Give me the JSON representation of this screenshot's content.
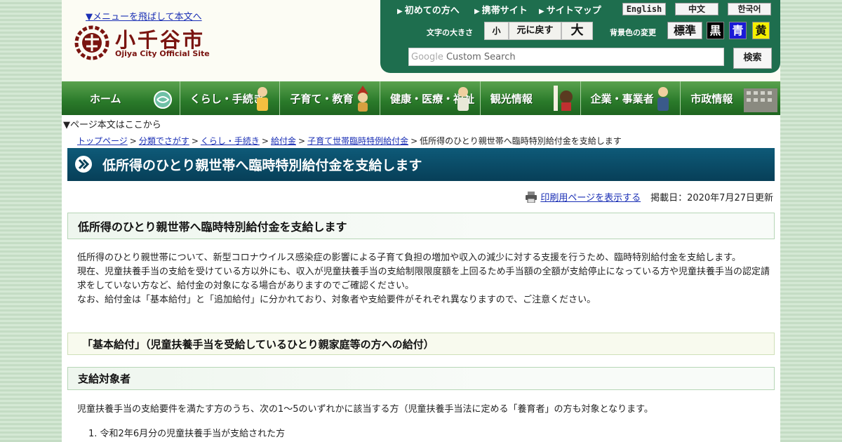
{
  "header": {
    "skip_link": "▼メニューを飛ばして本文へ",
    "logo_title": "小千谷市",
    "logo_sub": "Ojiya City Official Site"
  },
  "utility": {
    "links": [
      "初めての方へ",
      "携帯サイト",
      "サイトマップ"
    ],
    "languages": [
      "English",
      "中文",
      "한국어"
    ],
    "font_size_label": "文字の大きさ",
    "font_size_buttons": [
      "小",
      "元に戻す",
      "大"
    ],
    "bg_color_label": "背景色の変更",
    "color_buttons": [
      {
        "label": "標準",
        "bg": "#f4f4f4",
        "fg": "#111111"
      },
      {
        "label": "黒",
        "bg": "#000000",
        "fg": "#ffffff"
      },
      {
        "label": "青",
        "bg": "#1a1ad6",
        "fg": "#ffffff"
      },
      {
        "label": "黄",
        "bg": "#f4f000",
        "fg": "#111111"
      }
    ],
    "search_google": "Google",
    "search_placeholder": "Custom Search",
    "search_button": "検索"
  },
  "nav": [
    "ホーム",
    "くらし・手続き",
    "子育て・教育",
    "健康・医療・福祉",
    "観光情報",
    "企業・事業者",
    "市政情報"
  ],
  "content": {
    "content_start": "▼ページ本文はここから",
    "breadcrumb": [
      "トップページ",
      "分類でさがす",
      "くらし・手続き",
      "給付金",
      "子育て世帯臨時特例給付金"
    ],
    "breadcrumb_current": "低所得のひとり親世帯へ臨時特別給付金を支給します",
    "title": "低所得のひとり親世帯へ臨時特別給付金を支給します",
    "print_link": "印刷用ページを表示する",
    "posted_date": "掲載日：2020年7月27日更新",
    "heading1": "低所得のひとり親世帯へ臨時特別給付金を支給します",
    "intro_paragraphs": [
      "低所得のひとり親世帯について、新型コロナウイルス感染症の影響による子育て負担の増加や収入の減少に対する支援を行うため、臨時特別給付金を支給します。",
      "現在、児童扶養手当の支給を受けている方以外にも、収入が児童扶養手当の支給制限限度額を上回るため手当額の全額が支給停止になっている方や児童扶養手当の認定請求をしていない方など、給付金の対象になる場合がありますのでご確認ください。",
      "なお、給付金は「基本給付」と「追加給付」に分かれており、対象者や支給要件がそれぞれ異なりますので、ご注意ください。"
    ],
    "heading2": "「基本給付」（児童扶養手当を受給しているひとり親家庭等の方への給付）",
    "heading3": "支給対象者",
    "target_text": "児童扶養手当の支給要件を満たす方のうち、次の1～5のいずれかに該当する方（児童扶養手当法に定める「養育者」の方も対象となります。",
    "list_items": [
      "令和2年6月分の児童扶養手当が支給された方"
    ]
  }
}
